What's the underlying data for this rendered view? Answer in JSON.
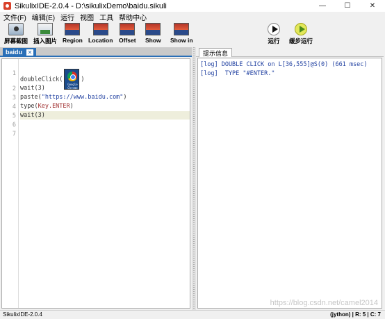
{
  "window": {
    "title": "SikulixIDE-2.0.4 - D:\\sikulixDemo\\baidu.sikuli",
    "minimize": "—",
    "maximize": "☐",
    "close": "✕"
  },
  "menu": [
    "文件(F)",
    "编辑(E)",
    "运行",
    "视图",
    "工具",
    "帮助中心"
  ],
  "toolbar": {
    "capture": "屏幕截图",
    "insert_image": "插入图片",
    "region": "Region",
    "location": "Location",
    "offset": "Offset",
    "show": "Show",
    "show_in": "Show in",
    "run": "运行",
    "run_slow": "缓步运行"
  },
  "editor": {
    "tab_name": "baidu",
    "tab_close": "✕",
    "line_numbers": [
      "1",
      "2",
      "3",
      "4",
      "5",
      "6",
      "7"
    ],
    "current_line": 5,
    "thumb_caption": "Google Chrome",
    "code": {
      "l1_fn": "doubleClick(",
      "l1_end": ")",
      "l2": "wait(3)",
      "l3_fn": "paste(",
      "l3_str": "\"https://www.baidu.com\"",
      "l3_end": ")",
      "l4_fn": "type(",
      "l4_key": "Key.ENTER",
      "l4_end": ")",
      "l5": "wait(3)"
    }
  },
  "messages": {
    "tab_label": "提示信息",
    "lines": [
      "[log] DOUBLE CLICK on L[36,555]@S(0) (661 msec)",
      "[log]  TYPE \"#ENTER.\""
    ]
  },
  "status": {
    "left": "SikulixIDE-2.0.4",
    "right": "(jython) | R: 5 | C: 7"
  },
  "watermark": "https://blog.csdn.net/camel2014"
}
